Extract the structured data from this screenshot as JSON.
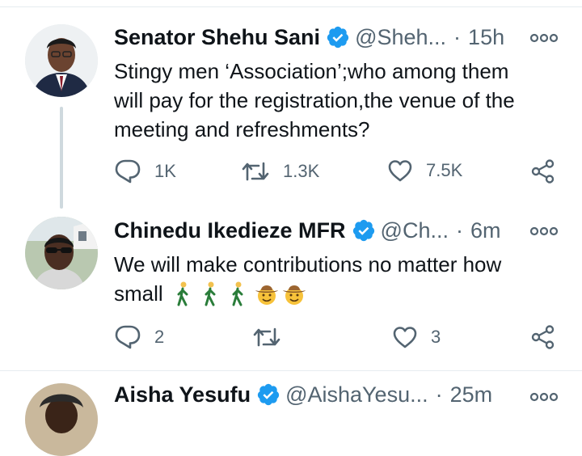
{
  "tweets": [
    {
      "name": "Senator Shehu Sani",
      "handle": "@Sheh...",
      "separator": "·",
      "time": "15h",
      "text_lines": [
        "Stingy men ‘Association’;who among them",
        "will pay for the registration,the venue of the",
        "meeting and refreshments?"
      ],
      "replies": "1K",
      "retweets": "1.3K",
      "likes": "7.5K"
    },
    {
      "name": "Chinedu Ikedieze MFR",
      "handle": "@Ch...",
      "separator": "·",
      "time": "6m",
      "text_line1": "We will make contributions no matter how",
      "text_line2": "small",
      "emojis": [
        "person-walking-emoji",
        "person-walking-emoji",
        "person-walking-emoji",
        "cowboy-face-emoji",
        "cowboy-face-emoji"
      ],
      "replies": "2",
      "retweets": "",
      "likes": "3"
    },
    {
      "name": "Aisha Yesufu",
      "handle": "@AishaYesu...",
      "separator": "·",
      "time": "25m"
    }
  ],
  "colors": {
    "verified": "#1d9bf0",
    "secondary_text": "#536471",
    "divider": "#e6ecf0"
  },
  "icons": [
    "verified-badge-icon",
    "more-options-icon",
    "reply-icon",
    "retweet-icon",
    "like-icon",
    "share-icon"
  ]
}
